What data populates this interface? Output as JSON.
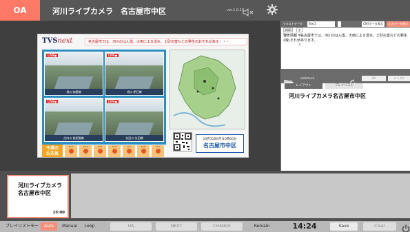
{
  "topbar": {
    "oa_label": "OA",
    "title": "河川ライブカメラ　名古屋市中区",
    "version": "ver.1.0.10"
  },
  "preview": {
    "logo_main": "TVS",
    "logo_sub": "next",
    "ticker": "名古屋市では、河川のはん濫、大雨による浸水、土砂災害などの発生のおそれがある・・・",
    "cameras": [
      {
        "live": "LIVE●",
        "caption": "堀川 納屋橋"
      },
      {
        "live": "LIVE●",
        "caption": "堀川 朝日橋"
      },
      {
        "live": "LIVE●",
        "caption": "庄内川 枇杷島橋"
      },
      {
        "live": "LIVE●",
        "caption": "矢田川 矢田橋"
      }
    ],
    "weather_label": "今週の\nお天気",
    "weather_days": [
      "10/1",
      "10/2",
      "10/3",
      "10/4",
      "10/5",
      "10/6",
      "10/7"
    ],
    "date_line": "10月31日(月)10時00分",
    "date_place": "名古屋市中区"
  },
  "right_panel": {
    "text_data_label": "テキストデータ",
    "text_select": "Text1",
    "cms_button": "CMSデータ表示",
    "input_button": "入力データ表示",
    "tab_cms": "CMSデータ",
    "tab_manual": "手動入力",
    "body_text": "警告情報　名古屋市では、河川のはん濫、大雨による浸水、土砂災害などの発生のおそれがあります。",
    "user": "nishimura",
    "oa_pill": "OA",
    "single_pill": "シングル",
    "tab_layout": "レイアウト",
    "tab_playlist": "プレイリスト",
    "content_title": "河川ライブカメラ名古屋市中区"
  },
  "playlist": {
    "item_title_1": "河川ライブカメラ",
    "item_title_2": "名古屋市中区",
    "item_time": "15:00"
  },
  "bottombar": {
    "mode_label": "プレイリストモード",
    "auto": "Auto",
    "manual": "Manual",
    "loop": "Loop",
    "oa": "OA",
    "next": "NEXT",
    "change": "CHANGE",
    "remain": "Remain",
    "clock": "14:24",
    "save": "Save",
    "clear": "Clear"
  },
  "colors": {
    "accent": "#f58f7c",
    "dark_bg": "#505050"
  }
}
